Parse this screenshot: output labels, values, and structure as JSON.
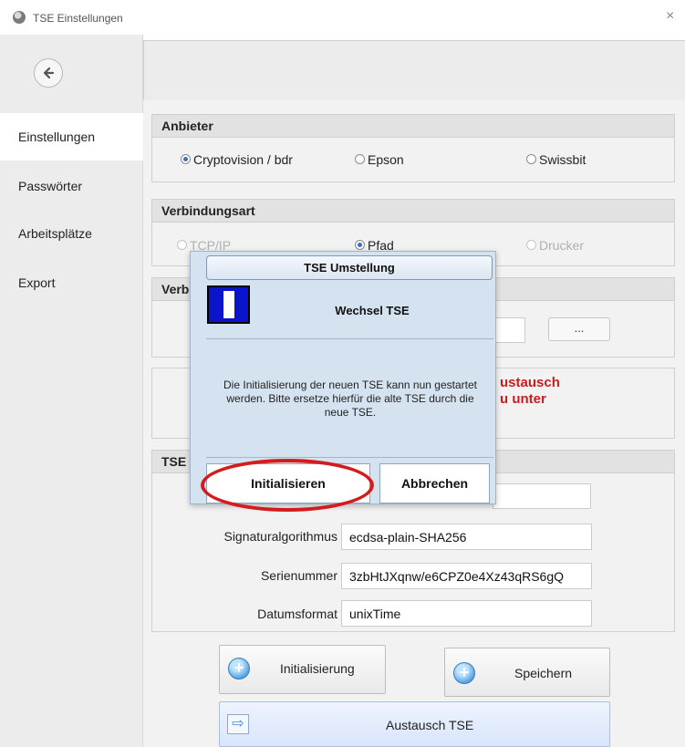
{
  "window": {
    "title": "TSE Einstellungen",
    "close_glyph": "×"
  },
  "sidebar": {
    "items": [
      {
        "label": "Einstellungen",
        "selected": true
      },
      {
        "label": "Passwörter",
        "selected": false
      },
      {
        "label": "Arbeitsplätze",
        "selected": false
      },
      {
        "label": "Export",
        "selected": false
      }
    ]
  },
  "anbieter": {
    "title": "Anbieter",
    "options": [
      {
        "label": "Cryptovision / bdr",
        "checked": true
      },
      {
        "label": "Epson",
        "checked": false
      },
      {
        "label": "Swissbit",
        "checked": false
      }
    ]
  },
  "verbindungsart": {
    "title": "Verbindungsart",
    "options": [
      {
        "label": "TCP/IP",
        "checked": false,
        "disabled": true
      },
      {
        "label": "Pfad",
        "checked": true,
        "disabled": false
      },
      {
        "label": "Drucker",
        "checked": false,
        "disabled": true
      }
    ]
  },
  "verbindung": {
    "title_fragment": "Verbi",
    "browse_label": "..."
  },
  "austausch_hint": {
    "line1": "ustausch",
    "line2": "u unter"
  },
  "tse_info": {
    "title_fragment": "TSE I",
    "fields": [
      {
        "label": "Signaturalgorithmus",
        "value": "ecdsa-plain-SHA256"
      },
      {
        "label": "Serienummer",
        "value": "3zbHtJXqnw/e6CPZ0e4Xz43qRS6gQ"
      },
      {
        "label": "Datumsformat",
        "value": "unixTime"
      }
    ]
  },
  "actions": {
    "initialize_label": "Initialisierung",
    "save_label": "Speichern",
    "exchange_label": "Austausch TSE"
  },
  "dialog": {
    "title": "TSE Umstellung",
    "headline": "Wechsel TSE",
    "message": "Die Initialisierung der neuen TSE kann nun gestartet werden. Bitte ersetze hierfür die alte TSE durch die neue TSE.",
    "confirm_label": "Initialisieren",
    "cancel_label": "Abbrechen",
    "highlight_color": "#d51b1b",
    "warning_color": "#0a14c8"
  }
}
